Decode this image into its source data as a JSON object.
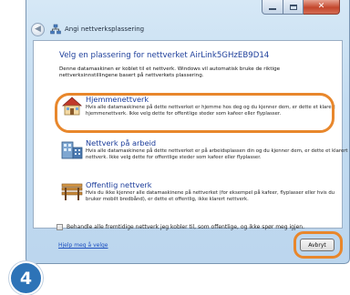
{
  "window": {
    "title": "Angi nettverksplassering",
    "caption_close": "✕"
  },
  "main": {
    "heading": "Velg en plassering for nettverket  AirLink5GHzEB9D14",
    "intro": "Denne datamaskinen er koblet til et nettverk. Windows vil automatisk bruke de riktige nettverksinnstillingene basert på nettverkets plassering."
  },
  "options": [
    {
      "title": "Hjemmenettverk",
      "description": "Hvis alle datamaskinene på dette nettverket er hjemme hos deg og du kjenner dem, er dette et klarert hjemmenettverk. Ikke velg dette for offentlige steder som kafeer eller flyplasser.",
      "icon": "home-network-icon"
    },
    {
      "title": "Nettverk på arbeid",
      "description": "Hvis alle datamaskinene på dette nettverket er på arbeidsplassen din og du kjenner dem, er dette et klarert nettverk. Ikke velg dette for offentlige steder som kafeer eller flyplasser.",
      "icon": "work-network-icon"
    },
    {
      "title": "Offentlig nettverk",
      "description": "Hvis du ikke kjenner alle datamaskinene på nettverket (for eksempel på kafeer, flyplasser eller hvis du bruker mobilt bredbånd), er dette et offentlig, ikke klarert nettverk.",
      "icon": "public-network-icon"
    }
  ],
  "checkbox": {
    "label": "Behandle alle fremtidige nettverk jeg kobler til, som offentlige, og ikke spør meg igjen.",
    "checked": false
  },
  "help_link": "Hjelp meg å velge",
  "buttons": {
    "cancel": "Avbryt"
  },
  "step_badge": "4",
  "colors": {
    "highlight": "#e8872c",
    "link": "#1b3c9a",
    "badge": "#2d73b7"
  }
}
